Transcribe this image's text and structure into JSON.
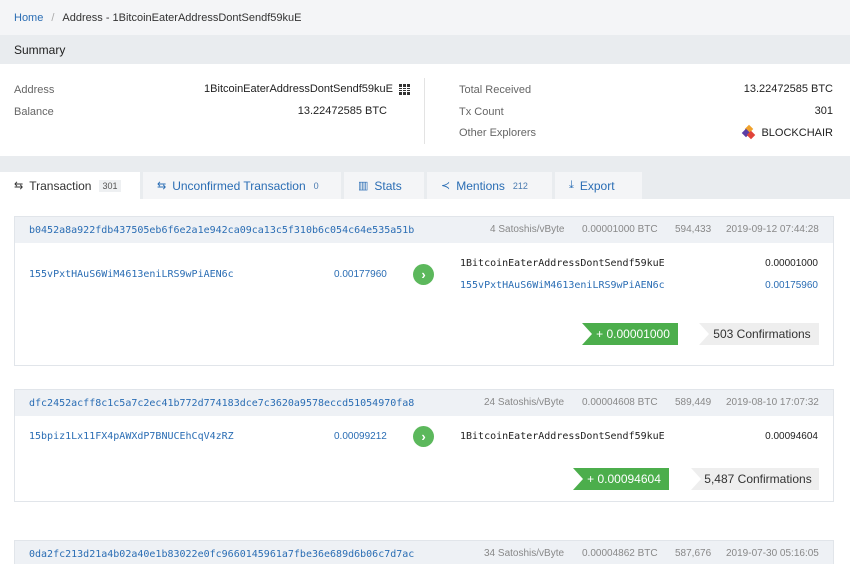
{
  "breadcrumb": {
    "home": "Home",
    "current": "Address - 1BitcoinEaterAddressDontSendf59kuE"
  },
  "summary": {
    "title": "Summary",
    "address_label": "Address",
    "address_value": "1BitcoinEaterAddressDontSendf59kuE",
    "balance_label": "Balance",
    "balance_value": "13.22472585 BTC",
    "total_received_label": "Total Received",
    "total_received_value": "13.22472585 BTC",
    "tx_count_label": "Tx Count",
    "tx_count_value": "301",
    "other_explorers_label": "Other Explorers",
    "explorer_name": "BLOCKCHAIR"
  },
  "tabs": [
    {
      "label": "Transaction",
      "count": "301",
      "icon": "transfer-icon"
    },
    {
      "label": "Unconfirmed Transaction",
      "count": "0",
      "icon": "transfer-icon"
    },
    {
      "label": "Stats",
      "count": "",
      "icon": "bar-chart-icon"
    },
    {
      "label": "Mentions",
      "count": "212",
      "icon": "share-icon"
    },
    {
      "label": "Export",
      "count": "",
      "icon": "download-icon"
    }
  ],
  "transactions": [
    {
      "hash": "b0452a8a922fdb437505eb6f6e2a1e942ca09ca13c5f310b6c054c64e535a51b",
      "fee_rate": "4 Satoshis/vByte",
      "fee": "0.00001000 BTC",
      "block": "594,433",
      "time": "2019-09-12 07:44:28",
      "inputs": [
        {
          "address": "155vPxtHAuS6WiM4613eniLRS9wPiAEN6c",
          "amount": "0.00177960"
        }
      ],
      "outputs": [
        {
          "address": "1BitcoinEaterAddressDontSendf59kuE",
          "amount": "0.00001000"
        },
        {
          "address": "155vPxtHAuS6WiM4613eniLRS9wPiAEN6c",
          "amount": "0.00175960"
        }
      ],
      "net": "+ 0.00001000",
      "confirmations": "503 Confirmations"
    },
    {
      "hash": "dfc2452acff8c1c5a7c2ec41b772d774183dce7c3620a9578eccd51054970fa8",
      "fee_rate": "24 Satoshis/vByte",
      "fee": "0.00004608 BTC",
      "block": "589,449",
      "time": "2019-08-10 17:07:32",
      "inputs": [
        {
          "address": "15bpiz1Lx11FX4pAWXdP7BNUCEhCqV4zRZ",
          "amount": "0.00099212"
        }
      ],
      "outputs": [
        {
          "address": "1BitcoinEaterAddressDontSendf59kuE",
          "amount": "0.00094604"
        }
      ],
      "net": "+ 0.00094604",
      "confirmations": "5,487 Confirmations"
    },
    {
      "hash": "0da2fc213d21a4b02a40e1b83022e0fc9660145961a7fbe36e689d6b06c7d7ac",
      "fee_rate": "34 Satoshis/vByte",
      "fee": "0.00004862 BTC",
      "block": "587,676",
      "time": "2019-07-30 05:16:05"
    }
  ]
}
